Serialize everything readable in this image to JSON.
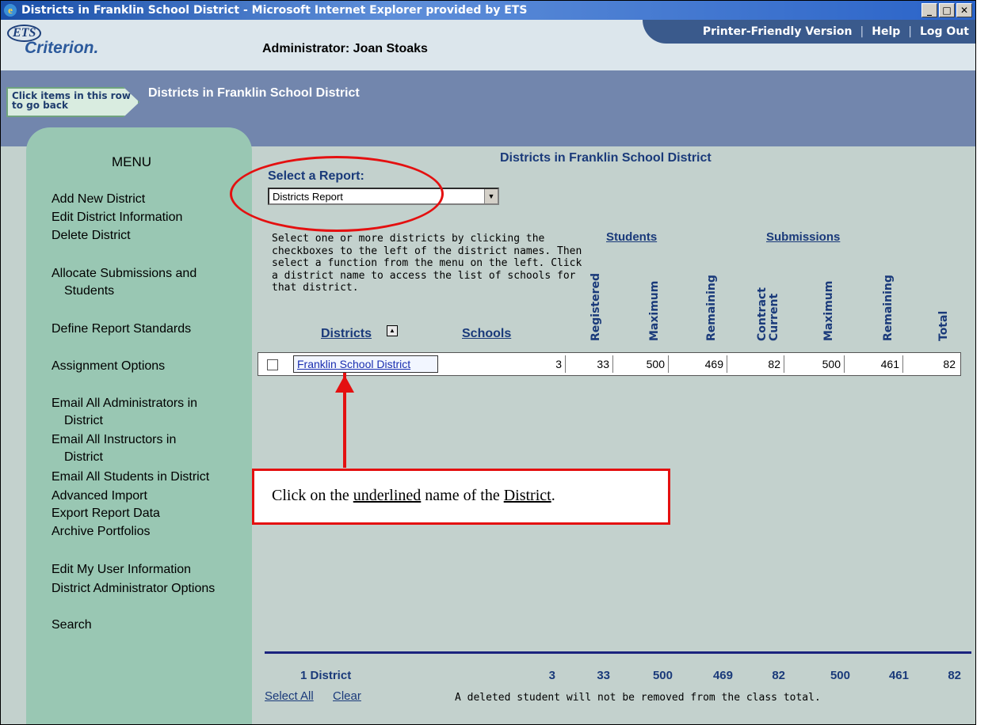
{
  "window": {
    "title": "Districts in Franklin School District - Microsoft Internet Explorer provided by ETS",
    "buttons": [
      "_",
      "□",
      "✕"
    ]
  },
  "header": {
    "logo_ets": "ETS",
    "logo_product": "Criterion.",
    "admin_label": "Administrator: Joan Stoaks",
    "links": [
      "Printer-Friendly Version",
      "Help",
      "Log Out"
    ]
  },
  "breadcrumb": {
    "back_hint": "Click items in this row to go back",
    "current": "Districts in Franklin School District"
  },
  "menu": {
    "title": "MENU",
    "items": [
      "Add New District",
      "Edit District Information",
      "Delete District",
      "Allocate Submissions and",
      "Students",
      "Define Report Standards",
      "Assignment Options",
      "Email All Administrators in",
      "District",
      "Email All Instructors in",
      "District",
      "Email All Students in District",
      "Advanced Import",
      "Export Report Data",
      "Archive Portfolios",
      "Edit My User Information",
      "District Administrator Options",
      "Search"
    ]
  },
  "report": {
    "heading": "Districts in Franklin School District",
    "select_label": "Select a Report:",
    "selected_report": "Districts Report",
    "instructions": "Select one or more districts by clicking the checkboxes to the left of the district names. Then select a function from the menu on the left. Click a district name to access the list of schools for that district."
  },
  "table": {
    "group_students": "Students",
    "group_submissions": "Submissions",
    "col_districts": "Districts",
    "col_schools": "Schools",
    "col_registered": "Registered",
    "col_maximum": "Maximum",
    "col_remaining": "Remaining",
    "col_current_contract_1": "Current",
    "col_current_contract_2": "Contract",
    "col_sub_maximum": "Maximum",
    "col_sub_remaining": "Remaining",
    "col_total": "Total",
    "rows": [
      {
        "district": "Franklin School District",
        "schools": "3",
        "registered": "33",
        "maximum": "500",
        "remaining": "469",
        "current_contract": "82",
        "sub_maximum": "500",
        "sub_remaining": "461",
        "total": "82"
      }
    ],
    "totals": {
      "label": "1 District",
      "schools": "3",
      "registered": "33",
      "maximum": "500",
      "remaining": "469",
      "current_contract": "82",
      "sub_maximum": "500",
      "sub_remaining": "461",
      "total": "82"
    }
  },
  "callout": {
    "prefix": "Click on the ",
    "underlined_1": "underlined",
    "middle": " name of the ",
    "underlined_2": "District",
    "suffix": "."
  },
  "footer": {
    "select_all": "Select All",
    "clear": "Clear",
    "note": "A deleted student will not be removed from the class total."
  },
  "colors": {
    "annotation": "#e41010",
    "menu_bg": "#99c7b3",
    "content_bg": "#c3d1cd",
    "heading_blue": "#1a3a7a"
  }
}
